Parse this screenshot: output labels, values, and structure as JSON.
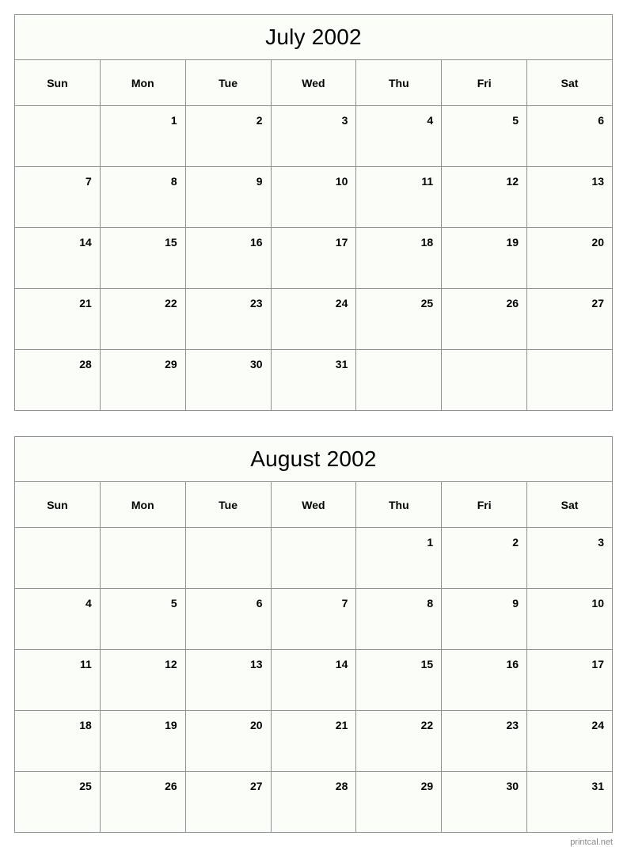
{
  "document": {
    "footer_credit": "printcal.net",
    "grid_line_color": "#919191",
    "cell_background": "#fbfdf8",
    "page_background": "#ffffff",
    "text_color": "#000000",
    "footer_color": "#8a8a8a"
  },
  "weekday_headers": [
    "Sun",
    "Mon",
    "Tue",
    "Wed",
    "Thu",
    "Fri",
    "Sat"
  ],
  "months": [
    {
      "title": "July 2002",
      "weeks": [
        [
          "",
          "1",
          "2",
          "3",
          "4",
          "5",
          "6"
        ],
        [
          "7",
          "8",
          "9",
          "10",
          "11",
          "12",
          "13"
        ],
        [
          "14",
          "15",
          "16",
          "17",
          "18",
          "19",
          "20"
        ],
        [
          "21",
          "22",
          "23",
          "24",
          "25",
          "26",
          "27"
        ],
        [
          "28",
          "29",
          "30",
          "31",
          "",
          "",
          ""
        ]
      ]
    },
    {
      "title": "August 2002",
      "weeks": [
        [
          "",
          "",
          "",
          "",
          "1",
          "2",
          "3"
        ],
        [
          "4",
          "5",
          "6",
          "7",
          "8",
          "9",
          "10"
        ],
        [
          "11",
          "12",
          "13",
          "14",
          "15",
          "16",
          "17"
        ],
        [
          "18",
          "19",
          "20",
          "21",
          "22",
          "23",
          "24"
        ],
        [
          "25",
          "26",
          "27",
          "28",
          "29",
          "30",
          "31"
        ]
      ]
    }
  ]
}
